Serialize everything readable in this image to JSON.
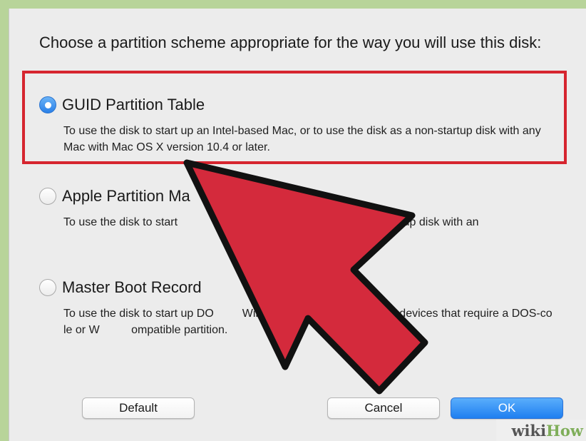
{
  "dialog": {
    "prompt": "Choose a partition scheme appropriate for the way you will use this disk:",
    "options": [
      {
        "label": "GUID Partition Table",
        "selected": true,
        "description": "To use the disk to start up an Intel-based Mac, or to use the disk as a non-startup disk with any Mac with Mac OS X version 10.4 or later."
      },
      {
        "label": "Apple Partition Ma",
        "selected": false,
        "description": "To use the disk to start                         to use the disk as a non-startup disk with an"
      },
      {
        "label": "Master Boot Record",
        "selected": false,
        "description": "To use the disk to start up DO         Win           uters, or to use with devices that require a DOS-co         le or W          ompatible partition."
      }
    ],
    "buttons": {
      "default": "Default",
      "cancel": "Cancel",
      "ok": "OK"
    }
  },
  "overlay": {
    "highlight_color": "#d6252f",
    "arrow_color": "#d42a3c",
    "watermark_part1": "wiki",
    "watermark_part2": "How"
  }
}
